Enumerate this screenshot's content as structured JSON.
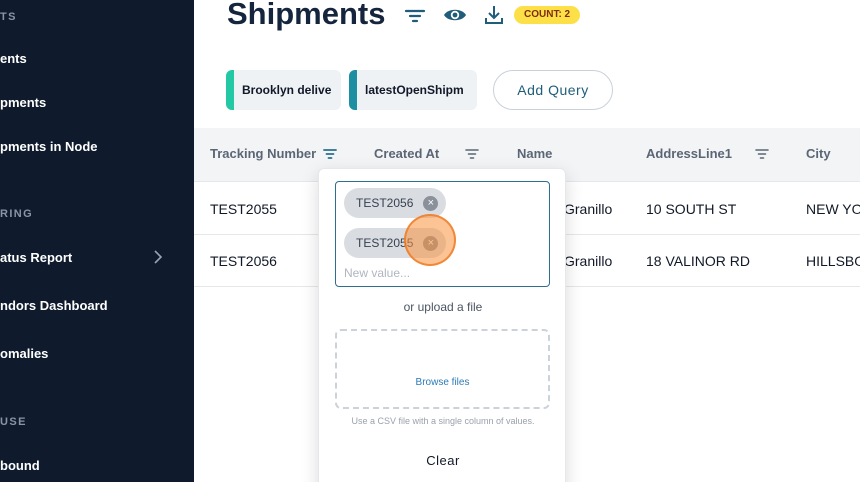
{
  "sidebar": {
    "sections": [
      {
        "label": "TS"
      },
      {
        "label": "RING"
      },
      {
        "label": "USE"
      }
    ],
    "items": [
      {
        "label": "ents"
      },
      {
        "label": "pments"
      },
      {
        "label": "pments in Node"
      },
      {
        "label": "atus Report"
      },
      {
        "label": "ndors Dashboard"
      },
      {
        "label": "omalies"
      },
      {
        "label": "bound"
      }
    ]
  },
  "header": {
    "title": "Shipments",
    "count_badge": "COUNT: 2"
  },
  "queries": {
    "chips": [
      {
        "label": "Brooklyn delive",
        "color": "#22c9a4"
      },
      {
        "label": "latestOpenShipm",
        "color": "#1e8fa3"
      }
    ],
    "add_label": "Add Query"
  },
  "table": {
    "columns": [
      "Tracking Number",
      "Created At",
      "Name",
      "AddressLine1",
      "City"
    ],
    "rows": [
      [
        "TEST2055",
        "",
        "Granillo",
        "10 SOUTH ST",
        "NEW YO"
      ],
      [
        "TEST2056",
        "",
        "Granillo",
        "18 VALINOR RD",
        "HILLSBO"
      ]
    ]
  },
  "filter_popover": {
    "tags": [
      "TEST2056",
      "TEST2055"
    ],
    "remove_glyph": "×",
    "input_placeholder": "New value...",
    "upload_note": "or upload a file",
    "browse_label": "Browse files",
    "csv_note": "Use a CSV file with a single column of values.",
    "clear_label": "Clear"
  },
  "colors": {
    "sidebar_bg": "#0f1b2d",
    "accent": "#2c6f8f",
    "badge": "#fde047"
  }
}
